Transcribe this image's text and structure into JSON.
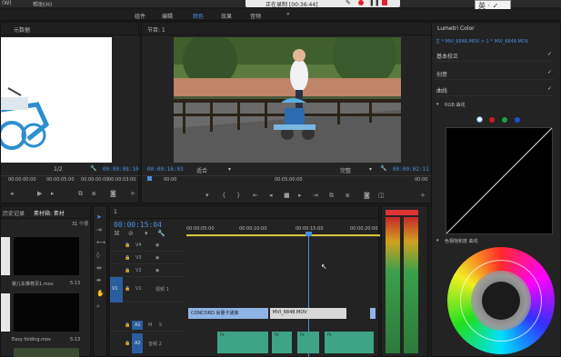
{
  "menu": {
    "left": "(W)",
    "help": "帮助(H)"
  },
  "recording_bar": {
    "status": "正在录制 [00:36:44]"
  },
  "workspaces": [
    "组件",
    "编辑",
    "颜色",
    "效果",
    "音频"
  ],
  "source_panel": {
    "tab": "元数据",
    "timecodes": [
      "00:00:00:00",
      "00:00:05:00",
      "00:00:00:00",
      "00:00:03:00"
    ],
    "zoom": "1/2",
    "duration": "00:00:08:10"
  },
  "program_panel": {
    "tab": "节目: 1",
    "current_time": "00:00:16:03",
    "fit": "适合",
    "quality": "完整",
    "duration": "00:00:02:11",
    "ruler": [
      "00:00",
      "00:05:00:00",
      "00:00"
    ]
  },
  "project_panel": {
    "tabs": [
      "历史记录",
      "素材箱: 素材"
    ],
    "item_count": "31 个项",
    "items": [
      {
        "name": "婴儿车推荐页1.mov",
        "duration": "5:13"
      },
      {
        "name": "Easy folding.mov",
        "duration": "5:13"
      }
    ]
  },
  "timeline": {
    "tab": "1",
    "timecode": "00:00:15:04",
    "ruler": [
      "00:00:05:00",
      "00:00:10:00",
      "00:00:15:00",
      "00:00:20:00"
    ],
    "tracks": [
      {
        "label": "V4",
        "name": ""
      },
      {
        "label": "V3",
        "name": ""
      },
      {
        "label": "V2",
        "name": ""
      },
      {
        "label": "V1",
        "name": "视频 1"
      },
      {
        "label": "A1",
        "name": ""
      },
      {
        "label": "A2",
        "name": "音频 2"
      }
    ],
    "clips": [
      {
        "name": "CONCORD 尚量卡通库",
        "color": "#8fb4e6"
      },
      {
        "name": "MVI_6848.MOV",
        "color": "#d8d8d8"
      }
    ],
    "audio_clips": [
      "fx",
      "fx",
      "fx",
      "fx"
    ]
  },
  "lumetri": {
    "title": "Lumetri Color",
    "source": "主 * MVI_6848.MOV  >  1 * MVI_6848.MOV",
    "sections": [
      "基本校正",
      "创意",
      "曲线"
    ],
    "curve_label": "RGB 曲线",
    "hue_label": "色相饱和度 曲线"
  },
  "colors": {
    "accent": "#4a8fe0",
    "clip_video": "#8fb4e6",
    "clip_white": "#d8d8d8",
    "audio_clip": "#3fa386",
    "playhead": "#4a8fe0"
  }
}
